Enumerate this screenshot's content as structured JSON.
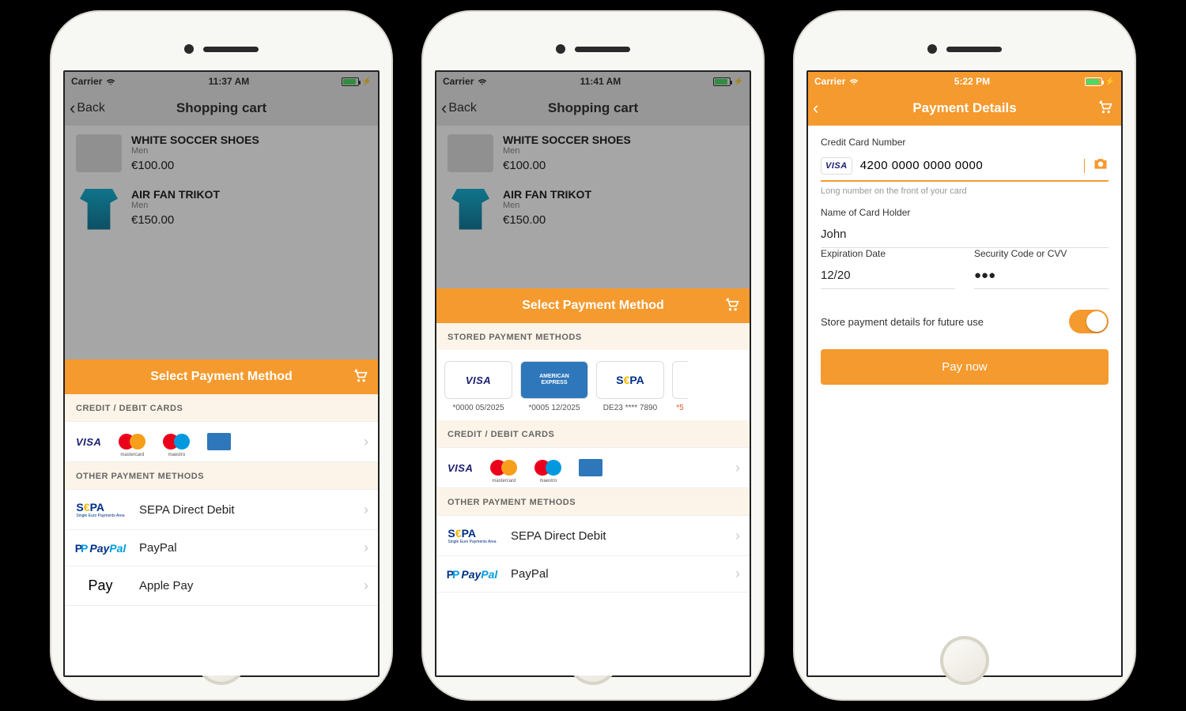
{
  "phone1": {
    "statusbar": {
      "carrier": "Carrier",
      "time": "11:37 AM"
    },
    "nav": {
      "back": "Back",
      "title": "Shopping cart"
    },
    "items": [
      {
        "name": "WHITE SOCCER SHOES",
        "sub": "Men",
        "price": "€100.00"
      },
      {
        "name": "AIR FAN TRIKOT",
        "sub": "Men",
        "price": "€150.00"
      }
    ],
    "sheet": {
      "title": "Select Payment Method",
      "section_cards": "CREDIT / DEBIT CARDS",
      "section_other": "OTHER PAYMENT METHODS",
      "methods": {
        "sepa": "SEPA Direct Debit",
        "paypal": "PayPal",
        "applepay": "Apple Pay"
      }
    }
  },
  "phone2": {
    "statusbar": {
      "carrier": "Carrier",
      "time": "11:41 AM"
    },
    "nav": {
      "back": "Back",
      "title": "Shopping cart"
    },
    "items": [
      {
        "name": "WHITE SOCCER SHOES",
        "sub": "Men",
        "price": "€100.00"
      },
      {
        "name": "AIR FAN TRIKOT",
        "sub": "Men",
        "price": "€150.00"
      }
    ],
    "sheet": {
      "title": "Select Payment Method",
      "section_stored": "STORED PAYMENT METHODS",
      "stored": [
        {
          "brand": "visa",
          "caption": "*0000 05/2025"
        },
        {
          "brand": "amex",
          "caption": "*0005 12/2025"
        },
        {
          "brand": "sepa",
          "caption": "DE23 **** 7890"
        },
        {
          "brand": "cut",
          "caption": "*5"
        }
      ],
      "section_cards": "CREDIT / DEBIT CARDS",
      "section_other": "OTHER PAYMENT METHODS",
      "methods": {
        "sepa": "SEPA Direct Debit",
        "paypal": "PayPal"
      }
    }
  },
  "phone3": {
    "statusbar": {
      "carrier": "Carrier",
      "time": "5:22 PM"
    },
    "nav": {
      "title": "Payment Details"
    },
    "form": {
      "cc_label": "Credit Card Number",
      "cc_value": "4200 0000 0000 0000",
      "cc_hint": "Long number on the front of your card",
      "name_label": "Name of Card Holder",
      "name_value": "John",
      "exp_label": "Expiration Date",
      "exp_value": "12/20",
      "cvv_label": "Security Code or CVV",
      "cvv_value": "●●●",
      "store_label": "Store payment details for future use",
      "pay_label": "Pay now"
    }
  }
}
